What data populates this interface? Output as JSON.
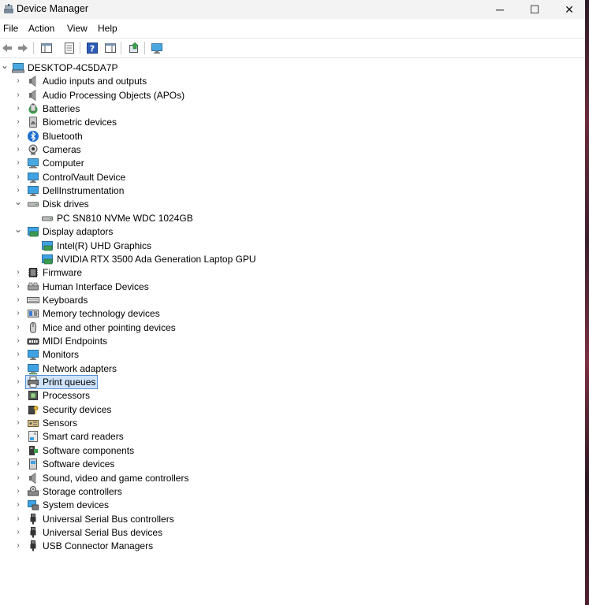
{
  "window": {
    "title": "Device Manager",
    "controls": {
      "minimize": "─",
      "maximize": "☐",
      "close": "✕"
    }
  },
  "menubar": [
    "File",
    "Action",
    "View",
    "Help"
  ],
  "toolbar": {
    "icons": [
      "back-icon",
      "forward-icon",
      "properties-pane-icon",
      "scan-icon",
      "help-icon",
      "device-view-icon",
      "update-driver-icon",
      "monitor-icon"
    ]
  },
  "tree": {
    "root": "DESKTOP-4C5DA7P",
    "items": [
      {
        "label": "Audio inputs and outputs",
        "icon": "speaker-icon",
        "expanded": false
      },
      {
        "label": "Audio Processing Objects (APOs)",
        "icon": "speaker-icon",
        "expanded": false
      },
      {
        "label": "Batteries",
        "icon": "battery-icon",
        "expanded": false
      },
      {
        "label": "Biometric devices",
        "icon": "fingerprint-icon",
        "expanded": false
      },
      {
        "label": "Bluetooth",
        "icon": "bluetooth-icon",
        "expanded": false
      },
      {
        "label": "Cameras",
        "icon": "camera-icon",
        "expanded": false
      },
      {
        "label": "Computer",
        "icon": "computer-icon",
        "expanded": false
      },
      {
        "label": "ControlVault Device",
        "icon": "monitor-icon",
        "expanded": false
      },
      {
        "label": "DellInstrumentation",
        "icon": "monitor-icon",
        "expanded": false
      },
      {
        "label": "Disk drives",
        "icon": "disk-icon",
        "expanded": true,
        "children": [
          {
            "label": "PC SN810 NVMe WDC 1024GB",
            "icon": "disk-icon"
          }
        ]
      },
      {
        "label": "Display adaptors",
        "icon": "display-adapter-icon",
        "expanded": true,
        "children": [
          {
            "label": "Intel(R) UHD Graphics",
            "icon": "display-adapter-icon"
          },
          {
            "label": "NVIDIA RTX 3500 Ada Generation Laptop GPU",
            "icon": "display-adapter-icon"
          }
        ]
      },
      {
        "label": "Firmware",
        "icon": "chip-icon",
        "expanded": false
      },
      {
        "label": "Human Interface Devices",
        "icon": "hid-icon",
        "expanded": false
      },
      {
        "label": "Keyboards",
        "icon": "keyboard-icon",
        "expanded": false
      },
      {
        "label": "Memory technology devices",
        "icon": "memory-icon",
        "expanded": false
      },
      {
        "label": "Mice and other pointing devices",
        "icon": "mouse-icon",
        "expanded": false
      },
      {
        "label": "MIDI Endpoints",
        "icon": "midi-icon",
        "expanded": false
      },
      {
        "label": "Monitors",
        "icon": "monitor-icon",
        "expanded": false
      },
      {
        "label": "Network adapters",
        "icon": "network-icon",
        "expanded": false
      },
      {
        "label": "Print queues",
        "icon": "printer-icon",
        "expanded": false,
        "selected": true
      },
      {
        "label": "Processors",
        "icon": "processor-icon",
        "expanded": false
      },
      {
        "label": "Security devices",
        "icon": "security-key-icon",
        "expanded": false
      },
      {
        "label": "Sensors",
        "icon": "sensor-icon",
        "expanded": false
      },
      {
        "label": "Smart card readers",
        "icon": "smart-card-icon",
        "expanded": false
      },
      {
        "label": "Software components",
        "icon": "software-component-icon",
        "expanded": false
      },
      {
        "label": "Software devices",
        "icon": "software-device-icon",
        "expanded": false
      },
      {
        "label": "Sound, video and game controllers",
        "icon": "speaker-icon",
        "expanded": false
      },
      {
        "label": "Storage controllers",
        "icon": "storage-controller-icon",
        "expanded": false
      },
      {
        "label": "System devices",
        "icon": "system-icon",
        "expanded": false
      },
      {
        "label": "Universal Serial Bus controllers",
        "icon": "usb-icon",
        "expanded": false
      },
      {
        "label": "Universal Serial Bus devices",
        "icon": "usb-icon",
        "expanded": false
      },
      {
        "label": "USB Connector Managers",
        "icon": "usb-icon",
        "expanded": false
      }
    ]
  },
  "colors": {
    "selection_bg": "#cfe3fb",
    "selection_border": "#5a8fd6",
    "accent": "#1e6fd1"
  }
}
